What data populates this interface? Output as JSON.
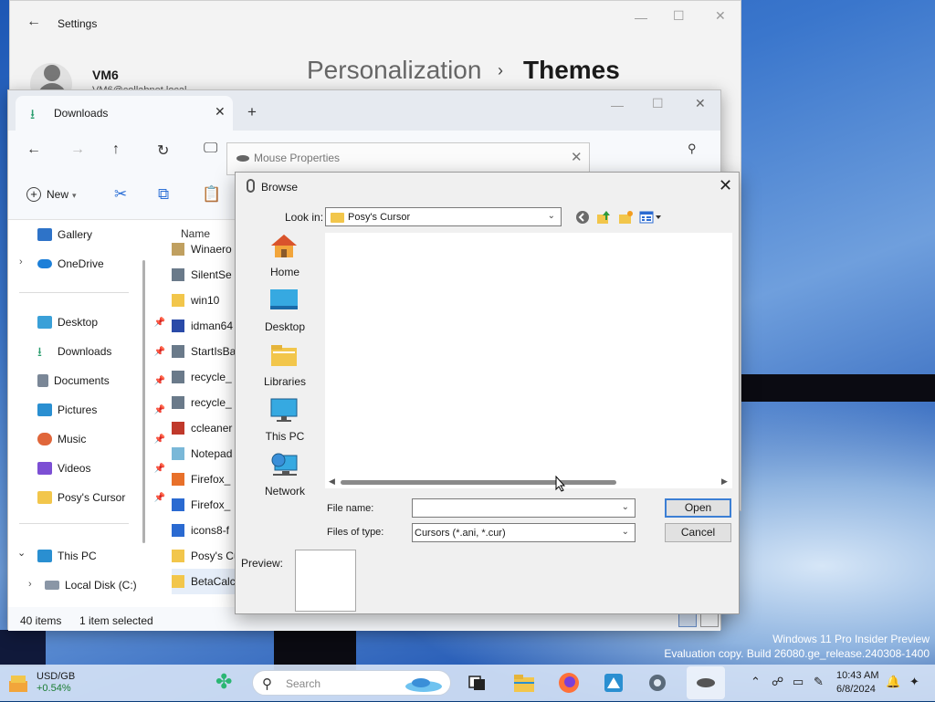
{
  "watermark": {
    "line1": "Windows 11 Pro Insider Preview",
    "line2": "Evaluation copy. Build 26080.ge_release.240308-1400"
  },
  "settings": {
    "title": "Settings",
    "user_name": "VM6",
    "user_email": "VM6@collabnet.local",
    "breadcrumb_parent": "Personalization",
    "breadcrumb_separator": "›",
    "breadcrumb_current": "Themes"
  },
  "explorer": {
    "tab_label": "Downloads",
    "new_label": "New",
    "column_name": "Name",
    "nav_items": [
      {
        "label": "Gallery",
        "color": "#2e73c8"
      },
      {
        "label": "OneDrive",
        "color": "#1c7fd8"
      },
      {
        "label": "Desktop",
        "color": "#3aa0d8"
      },
      {
        "label": "Downloads",
        "color": "#2a9d6e"
      },
      {
        "label": "Documents",
        "color": "#7a8797"
      },
      {
        "label": "Pictures",
        "color": "#2a8fd1"
      },
      {
        "label": "Music",
        "color": "#e0663a"
      },
      {
        "label": "Videos",
        "color": "#7c4fd4"
      },
      {
        "label": "Posy's Cursor",
        "color": "#f2c64b"
      },
      {
        "label": "This PC",
        "color": "#2a8fd1"
      },
      {
        "label": "Local Disk (C:)",
        "color": "#8a96a6"
      }
    ],
    "files": [
      {
        "name": "Winaero",
        "color": "#c0a060"
      },
      {
        "name": "SilentSe",
        "color": "#6a7a8a"
      },
      {
        "name": "win10",
        "color": "#f2c64b"
      },
      {
        "name": "idman64",
        "color": "#2a4aa8"
      },
      {
        "name": "StartIsBa",
        "color": "#6a7a8a"
      },
      {
        "name": "recycle_",
        "color": "#6a7a8a"
      },
      {
        "name": "recycle_",
        "color": "#6a7a8a"
      },
      {
        "name": "ccleaner",
        "color": "#c0392b"
      },
      {
        "name": "Notepad",
        "color": "#7ab8d8"
      },
      {
        "name": "Firefox_",
        "color": "#e8702a"
      },
      {
        "name": "Firefox_",
        "color": "#2a6ad1"
      },
      {
        "name": "icons8-f",
        "color": "#2a6ad1"
      },
      {
        "name": "Posy's Cu",
        "color": "#f2c64b"
      },
      {
        "name": "BetaCalcu",
        "color": "#f2c64b"
      }
    ],
    "status_items": "40 items",
    "status_selected": "1 item selected"
  },
  "mouse_properties": {
    "title": "Mouse Properties"
  },
  "browse": {
    "title": "Browse",
    "look_in_label": "Look in:",
    "look_in_value": "Posy's Cursor",
    "places": [
      {
        "label": "Home",
        "icon": "home-icon"
      },
      {
        "label": "Desktop",
        "icon": "desktop-icon"
      },
      {
        "label": "Libraries",
        "icon": "libraries-icon"
      },
      {
        "label": "This PC",
        "icon": "this-pc-icon"
      },
      {
        "label": "Network",
        "icon": "network-icon"
      }
    ],
    "file_name_label": "File name:",
    "file_name_value": "",
    "files_of_type_label": "Files of type:",
    "files_of_type_value": "Cursors (*.ani, *.cur)",
    "open_label": "Open",
    "cancel_label": "Cancel",
    "preview_label": "Preview:"
  },
  "taskbar": {
    "stock_symbol": "USD/GB",
    "stock_change": "+0.54%",
    "search_placeholder": "Search",
    "time": "10:43 AM",
    "date": "6/8/2024"
  }
}
